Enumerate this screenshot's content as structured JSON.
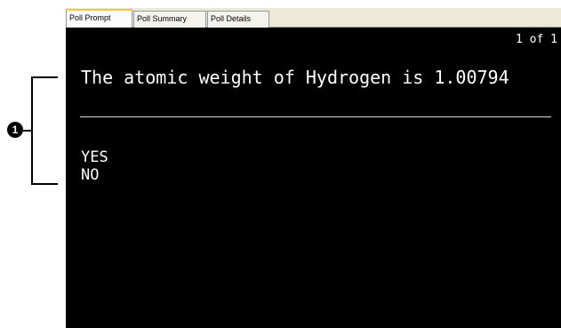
{
  "tabs": [
    {
      "label": "Poll Prompt",
      "active": true
    },
    {
      "label": "Poll Summary",
      "active": false
    },
    {
      "label": "Poll Details",
      "active": false
    }
  ],
  "display": {
    "counter": "1 of 1",
    "question": "The atomic weight of Hydrogen is 1.00794",
    "answers": [
      "YES",
      "NO"
    ]
  },
  "callout": {
    "number": "1"
  },
  "colors": {
    "display_background": "#000000",
    "display_text": "#ffffff",
    "active_tab_highlight": "#ffc83c"
  }
}
